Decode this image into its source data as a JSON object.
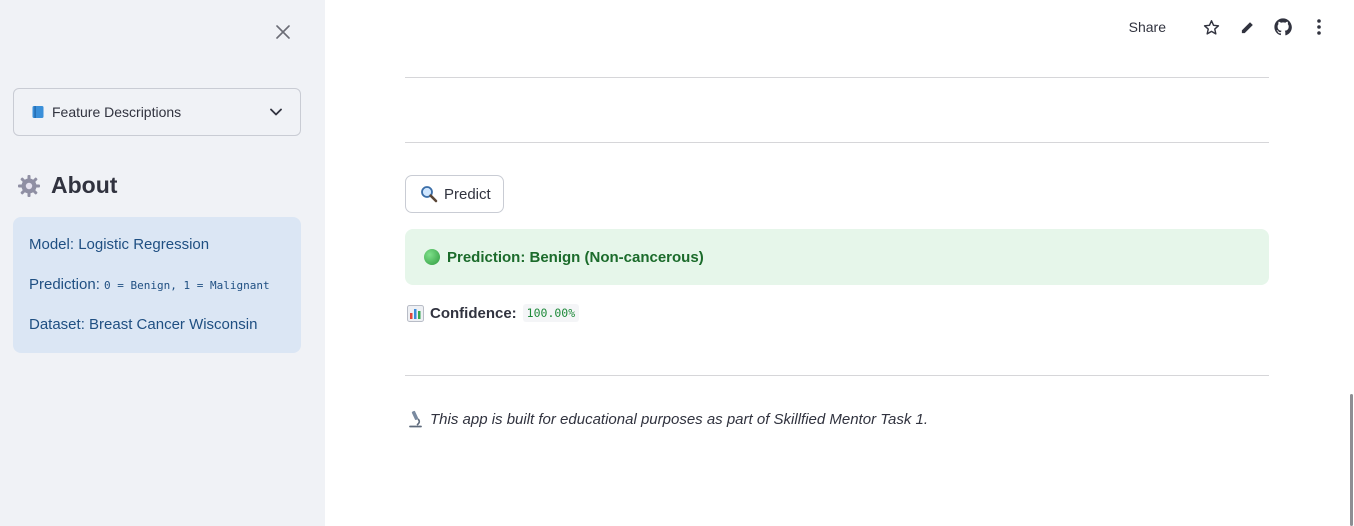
{
  "sidebar": {
    "expander_label": "Feature Descriptions",
    "about_title": "About",
    "info": {
      "model_text": "Model: Logistic Regression",
      "prediction_label": "Prediction: ",
      "prediction_code": "0 = Benign, 1 = Malignant",
      "dataset_text": "Dataset: Breast Cancer Wisconsin"
    }
  },
  "toolbar": {
    "share_label": "Share",
    "icons": [
      "star-icon",
      "pencil-icon",
      "github-icon",
      "more-vert-icon"
    ]
  },
  "main": {
    "predict_button_label": "Predict",
    "prediction_result": "Prediction: Benign (Non-cancerous)",
    "confidence_label": "Confidence:",
    "confidence_value": "100.00%",
    "footer_text": "This app is built for educational purposes as part of Skillfied Mentor Task 1."
  },
  "colors": {
    "sidebar_bg": "#f0f2f6",
    "info_bg": "#dbe6f4",
    "info_text": "#1f4f82",
    "success_bg": "#e6f6ea",
    "success_text": "#1b6b2b",
    "code_green": "#1e8a3a"
  }
}
